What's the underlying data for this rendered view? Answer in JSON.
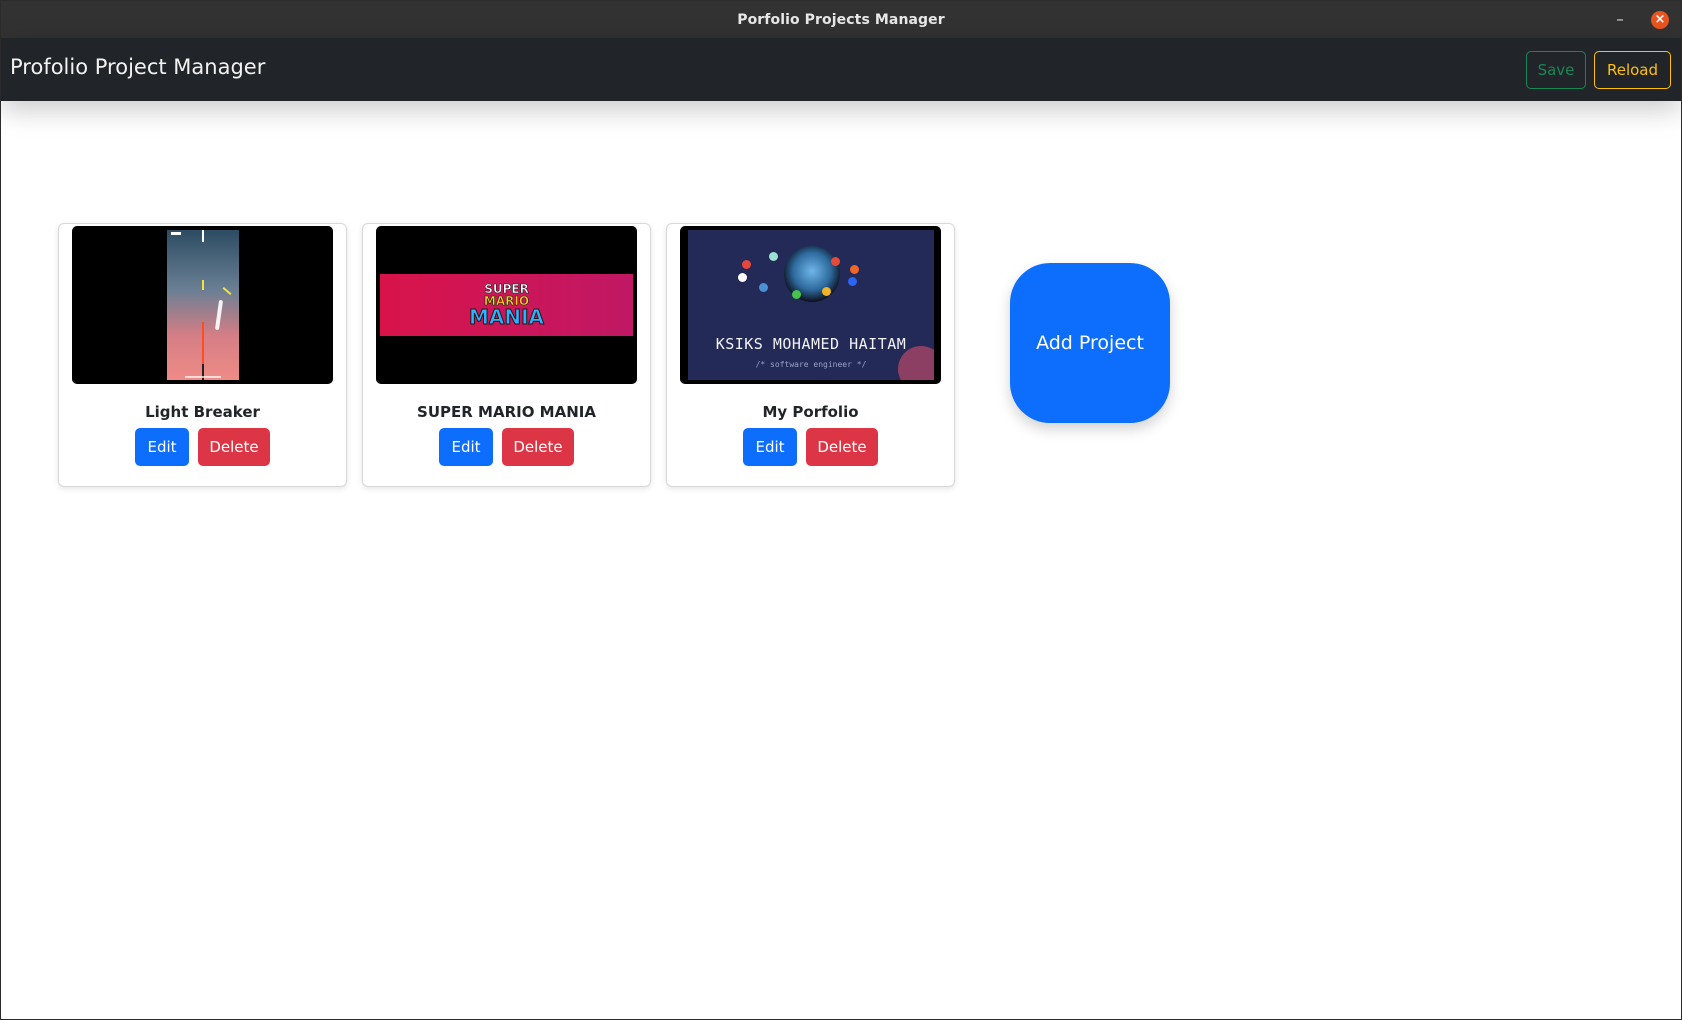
{
  "window": {
    "title": "Porfolio Projects Manager",
    "minimize_glyph": "–",
    "close_glyph": "×"
  },
  "navbar": {
    "brand": "Profolio Project Manager",
    "save_label": "Save",
    "reload_label": "Reload"
  },
  "projects": [
    {
      "name": "Light Breaker",
      "edit_label": "Edit",
      "delete_label": "Delete"
    },
    {
      "name": "SUPER MARIO MANIA",
      "edit_label": "Edit",
      "delete_label": "Delete",
      "logo": {
        "line1": "SUPER",
        "line2": "MARIO",
        "line3": "MANIA"
      }
    },
    {
      "name": "My Porfolio",
      "edit_label": "Edit",
      "delete_label": "Delete",
      "thumb_title": "KSIKS MOHAMED HAITAM",
      "thumb_subtitle": "/* software engineer */"
    }
  ],
  "add_project_label": "Add Project",
  "colors": {
    "primary": "#0d6efd",
    "danger": "#dc3545",
    "success": "#198754",
    "warning": "#ffc107",
    "navbar": "#212529",
    "titlebar": "#323232",
    "close": "#e95420"
  }
}
